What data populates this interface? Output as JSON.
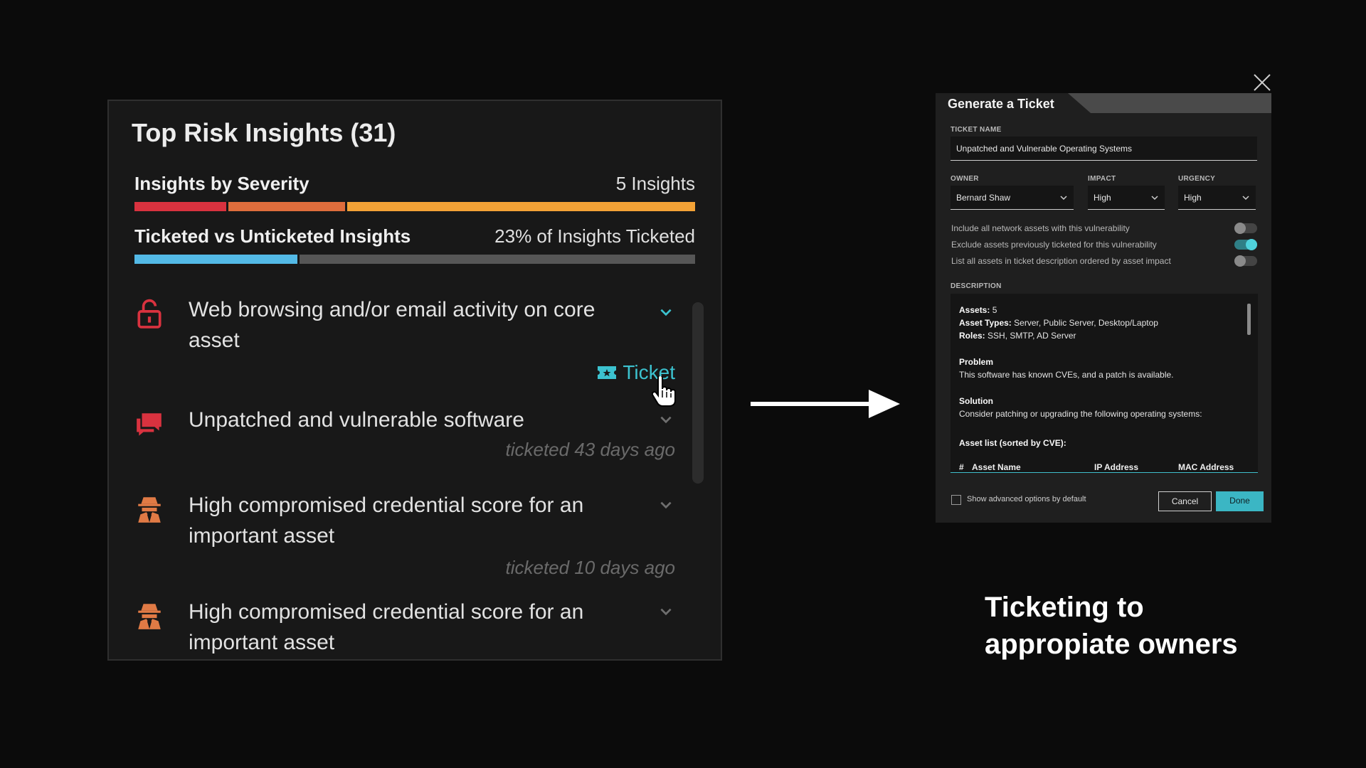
{
  "panel": {
    "title": "Top Risk Insights (31)",
    "severity": {
      "label": "Insights by Severity",
      "value": "5 Insights",
      "segments": [
        {
          "color": "#d9323f",
          "share": 0.165
        },
        {
          "color": "#df6d3c",
          "share": 0.21
        },
        {
          "color": "#f3a236",
          "share": 0.625
        }
      ]
    },
    "ticketed": {
      "label": "Ticketed vs Unticketed Insights",
      "value": "23% of Insights Ticketed",
      "fraction": 0.29,
      "color_ticketed": "#53b9e6",
      "color_rest": "#565656"
    },
    "insights": [
      {
        "icon": "unlock-icon",
        "text": "Web browsing and/or email activity on core asset",
        "action": "Ticket",
        "meta": ""
      },
      {
        "icon": "chat-icon",
        "text": "Unpatched and vulnerable software",
        "action": "",
        "meta": "ticketed 43 days ago"
      },
      {
        "icon": "spy-icon",
        "text": "High compromised credential score for an important asset",
        "action": "",
        "meta": "ticketed 10 days ago"
      },
      {
        "icon": "spy-icon",
        "text": "High compromised credential score for an important asset",
        "action": "",
        "meta": ""
      }
    ]
  },
  "modal": {
    "title": "Generate a Ticket",
    "ticket_name_label": "TICKET NAME",
    "ticket_name": "Unpatched and Vulnerable Operating Systems",
    "owner_label": "OWNER",
    "owner": "Bernard Shaw",
    "impact_label": "IMPACT",
    "impact": "High",
    "urgency_label": "URGENCY",
    "urgency": "High",
    "toggles": [
      {
        "label": "Include all network assets with this vulnerability",
        "on": false
      },
      {
        "label": "Exclude assets previously ticketed for this vulnerability",
        "on": true
      },
      {
        "label": "List all assets in ticket description ordered by asset impact",
        "on": false
      }
    ],
    "description_label": "DESCRIPTION",
    "description": {
      "assets_key": "Assets:",
      "assets_val": "5",
      "types_key": "Asset Types:",
      "types_val": "Server, Public Server, Desktop/Laptop",
      "roles_key": "Roles:",
      "roles_val": "SSH, SMTP, AD Server",
      "problem_title": "Problem",
      "problem_text": "This software has known CVEs, and a patch is available.",
      "solution_title": "Solution",
      "solution_text": "Consider patching or upgrading the following operating systems:",
      "asset_list_title": "Asset list (sorted by CVE):",
      "columns": [
        "#",
        "Asset Name",
        "IP Address",
        "MAC Address"
      ]
    },
    "advanced_label": "Show advanced options by default",
    "cancel_label": "Cancel",
    "done_label": "Done",
    "accent": "#3bb6c4"
  },
  "caption": {
    "line1": "Ticketing to",
    "line2": "appropiate owners"
  }
}
